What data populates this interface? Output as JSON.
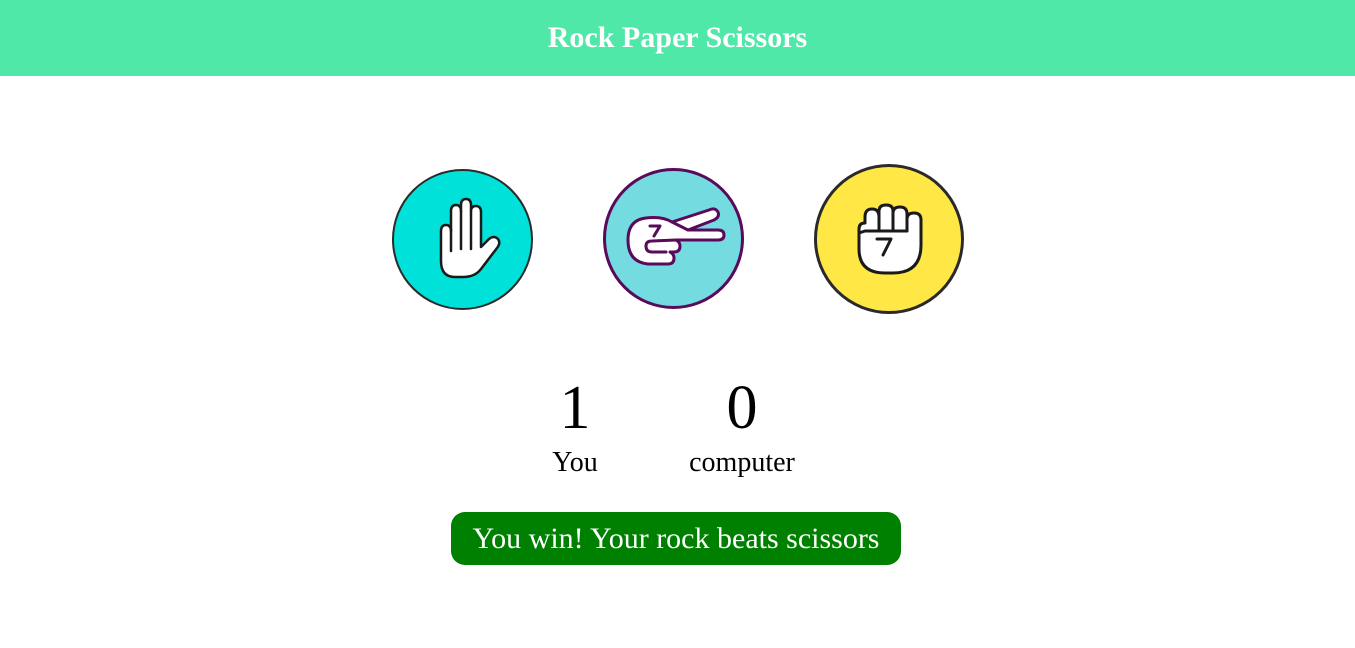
{
  "header": {
    "title": "Rock Paper Scissors",
    "background": "#50e8a8"
  },
  "choices": [
    {
      "id": "paper",
      "icon": "raised-hand-icon",
      "color": "#00e1d9"
    },
    {
      "id": "scissors",
      "icon": "scissors-hand-icon",
      "color": "#74dbe1"
    },
    {
      "id": "rock",
      "icon": "fist-icon",
      "color": "#ffe845"
    }
  ],
  "scoreboard": {
    "user": {
      "score": "1",
      "label": "You"
    },
    "computer": {
      "score": "0",
      "label": "computer"
    }
  },
  "result": {
    "message": "You win! Your rock beats scissors",
    "background": "#008000",
    "status": "win"
  }
}
